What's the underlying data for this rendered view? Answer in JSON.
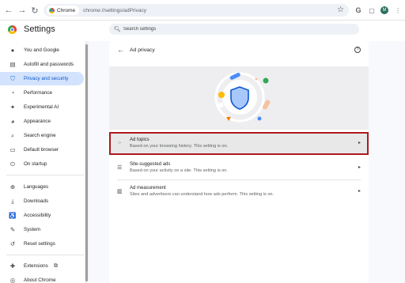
{
  "browser": {
    "site_chip": "Chrome",
    "url": "chrome://settings/adPrivacy",
    "avatar_letter": "M"
  },
  "header": {
    "title": "Settings",
    "search_placeholder": "Search settings"
  },
  "sidebar": {
    "items": [
      {
        "label": "You and Google",
        "icon": "person-icon"
      },
      {
        "label": "Autofill and passwords",
        "icon": "clipboard-icon"
      },
      {
        "label": "Privacy and security",
        "icon": "shield-icon",
        "active": true
      },
      {
        "label": "Performance",
        "icon": "speedometer-icon"
      },
      {
        "label": "Experimental AI",
        "icon": "sparkle-icon"
      },
      {
        "label": "Appearance",
        "icon": "palette-icon"
      },
      {
        "label": "Search engine",
        "icon": "search-icon"
      },
      {
        "label": "Default browser",
        "icon": "browser-icon"
      },
      {
        "label": "On startup",
        "icon": "power-icon"
      },
      {
        "label": "Languages",
        "icon": "globe-icon"
      },
      {
        "label": "Downloads",
        "icon": "download-icon"
      },
      {
        "label": "Accessibility",
        "icon": "accessibility-icon"
      },
      {
        "label": "System",
        "icon": "wrench-icon"
      },
      {
        "label": "Reset settings",
        "icon": "reset-icon"
      },
      {
        "label": "Extensions",
        "icon": "puzzle-icon"
      },
      {
        "label": "About Chrome",
        "icon": "chrome-icon"
      }
    ]
  },
  "page": {
    "title": "Ad privacy",
    "rows": [
      {
        "title": "Ad topics",
        "desc": "Based on your browsing history. This setting is on.",
        "icon": "topics-icon"
      },
      {
        "title": "Site-suggested ads",
        "desc": "Based on your activity on a site. This setting is on.",
        "icon": "list-icon"
      },
      {
        "title": "Ad measurement",
        "desc": "Sites and advertisers can understand how ads perform. This setting is on.",
        "icon": "chart-icon"
      }
    ]
  },
  "colors": {
    "accent": "#0b57d0",
    "active_bg": "#d3e3fd",
    "highlight_border": "#b0191e"
  }
}
